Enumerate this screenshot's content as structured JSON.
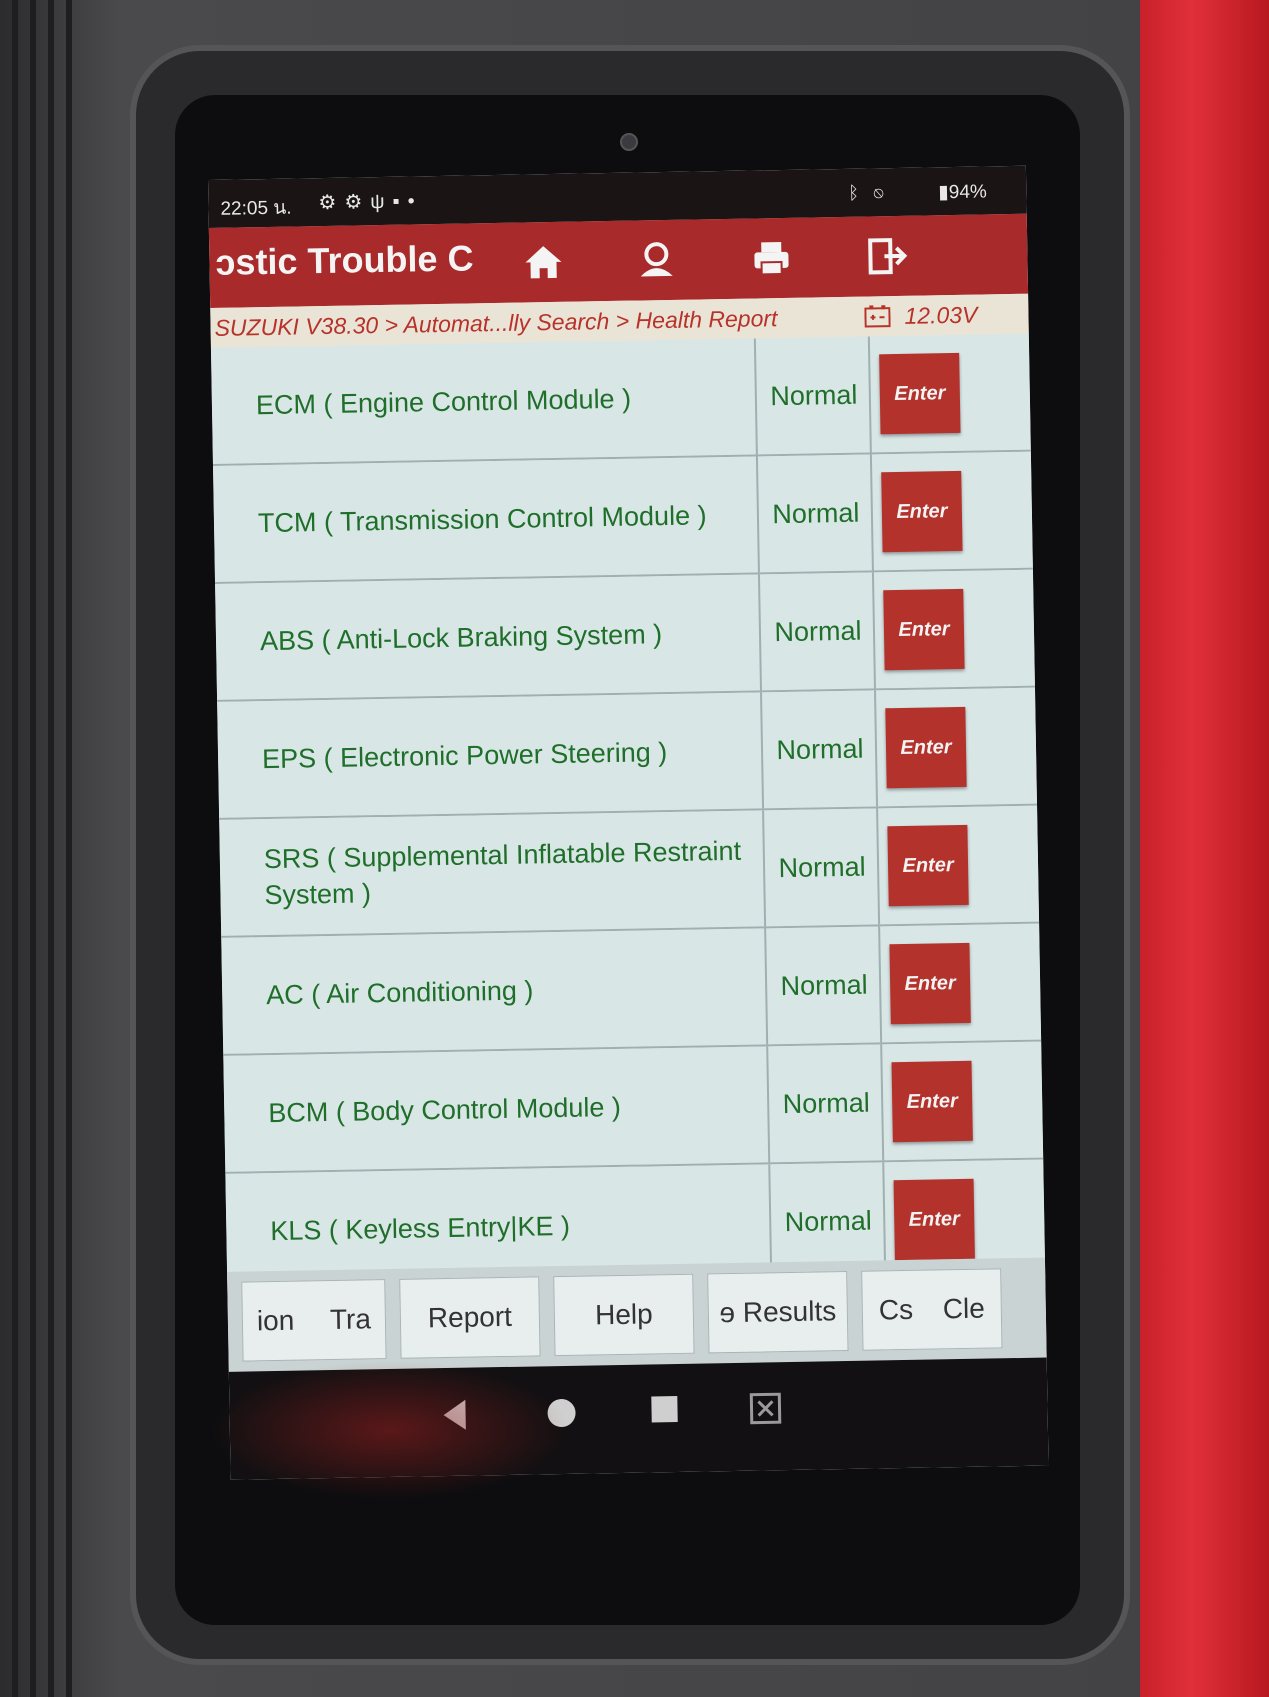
{
  "status_bar": {
    "time": "22:05 น.",
    "left_icons": [
      "gear-icon",
      "gear-icon",
      "usb-icon",
      "image-icon",
      "dot-icon"
    ],
    "right_icons": [
      "bluetooth-icon",
      "mute-icon"
    ],
    "battery": "94%"
  },
  "title_bar": {
    "title": "ɔstic Trouble C",
    "icons": [
      "home-icon",
      "user-icon",
      "print-icon",
      "exit-icon"
    ],
    "color": "#a82a2a"
  },
  "breadcrumb": {
    "path": "SUZUKI V38.30 > Automat...lly Search > Health Report",
    "voltage": "12.03V"
  },
  "modules": [
    {
      "name": "ECM ( Engine Control Module )",
      "status": "Normal",
      "action": "Enter"
    },
    {
      "name": "TCM ( Transmission Control Module )",
      "status": "Normal",
      "action": "Enter"
    },
    {
      "name": "ABS ( Anti-Lock Braking System )",
      "status": "Normal",
      "action": "Enter"
    },
    {
      "name": "EPS ( Electronic Power Steering )",
      "status": "Normal",
      "action": "Enter"
    },
    {
      "name": "SRS ( Supplemental Inflatable Restraint System )",
      "status": "Normal",
      "action": "Enter"
    },
    {
      "name": "AC ( Air Conditioning )",
      "status": "Normal",
      "action": "Enter"
    },
    {
      "name": "BCM ( Body Control Module )",
      "status": "Normal",
      "action": "Enter"
    },
    {
      "name": "KLS ( Keyless Entry|KE )",
      "status": "Normal",
      "action": "Enter"
    }
  ],
  "bottom_buttons": {
    "b1": "ion",
    "b2": "Tra",
    "b3": "Report",
    "b4": "Help",
    "b5": "ɘ Results",
    "b6": "Cs",
    "b7": "Cle"
  },
  "nav_icons": [
    "back-icon",
    "home-circle-icon",
    "recents-icon",
    "screenshot-icon"
  ],
  "colors": {
    "accent_red": "#b3322c",
    "text_green": "#1f6f2a",
    "row_bg": "#d9e6e6"
  }
}
